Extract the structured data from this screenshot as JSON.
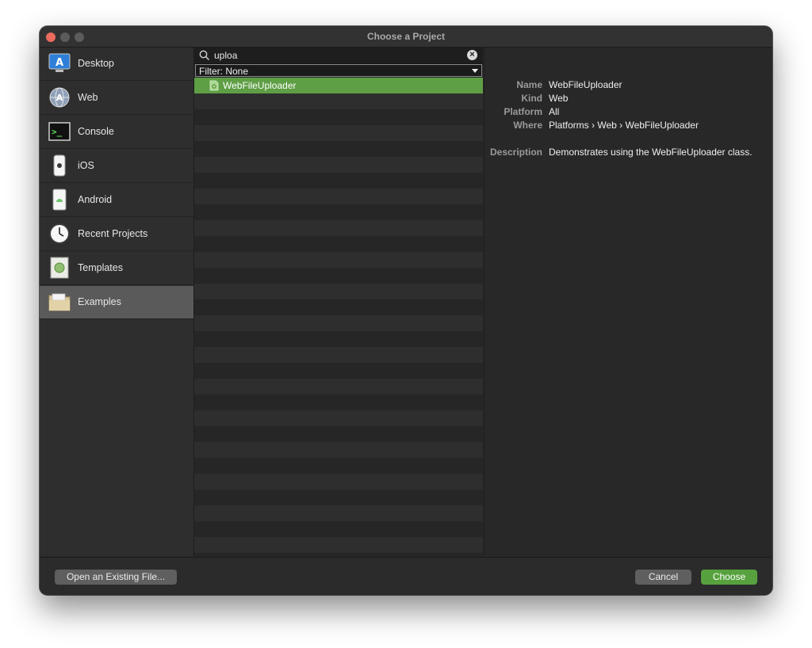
{
  "window": {
    "title": "Choose a Project"
  },
  "sidebar": {
    "items": [
      {
        "label": "Desktop",
        "icon": "desktop-app-icon"
      },
      {
        "label": "Web",
        "icon": "web-app-icon"
      },
      {
        "label": "Console",
        "icon": "terminal-icon"
      },
      {
        "label": "iOS",
        "icon": "iphone-icon"
      },
      {
        "label": "Android",
        "icon": "android-phone-icon"
      },
      {
        "label": "Recent Projects",
        "icon": "clock-icon"
      },
      {
        "label": "Templates",
        "icon": "template-document-icon"
      },
      {
        "label": "Examples",
        "icon": "folder-icon",
        "selected": true
      }
    ]
  },
  "search": {
    "value": "uploa"
  },
  "filter": {
    "label": "Filter: None"
  },
  "list": {
    "items": [
      {
        "label": "WebFileUploader",
        "selected": true
      }
    ]
  },
  "details": {
    "name_key": "Name",
    "name_value": "WebFileUploader",
    "kind_key": "Kind",
    "kind_value": "Web",
    "platform_key": "Platform",
    "platform_value": "All",
    "where_key": "Where",
    "where_value": "Platforms › Web › WebFileUploader",
    "description_key": "Description",
    "description_value": "Demonstrates using the WebFileUploader class."
  },
  "footer": {
    "open_label": "Open an Existing File...",
    "cancel_label": "Cancel",
    "choose_label": "Choose"
  },
  "colors": {
    "accent_green": "#57a23e",
    "selected_row": "#5e9e45",
    "close_button": "#ed6a5e"
  }
}
